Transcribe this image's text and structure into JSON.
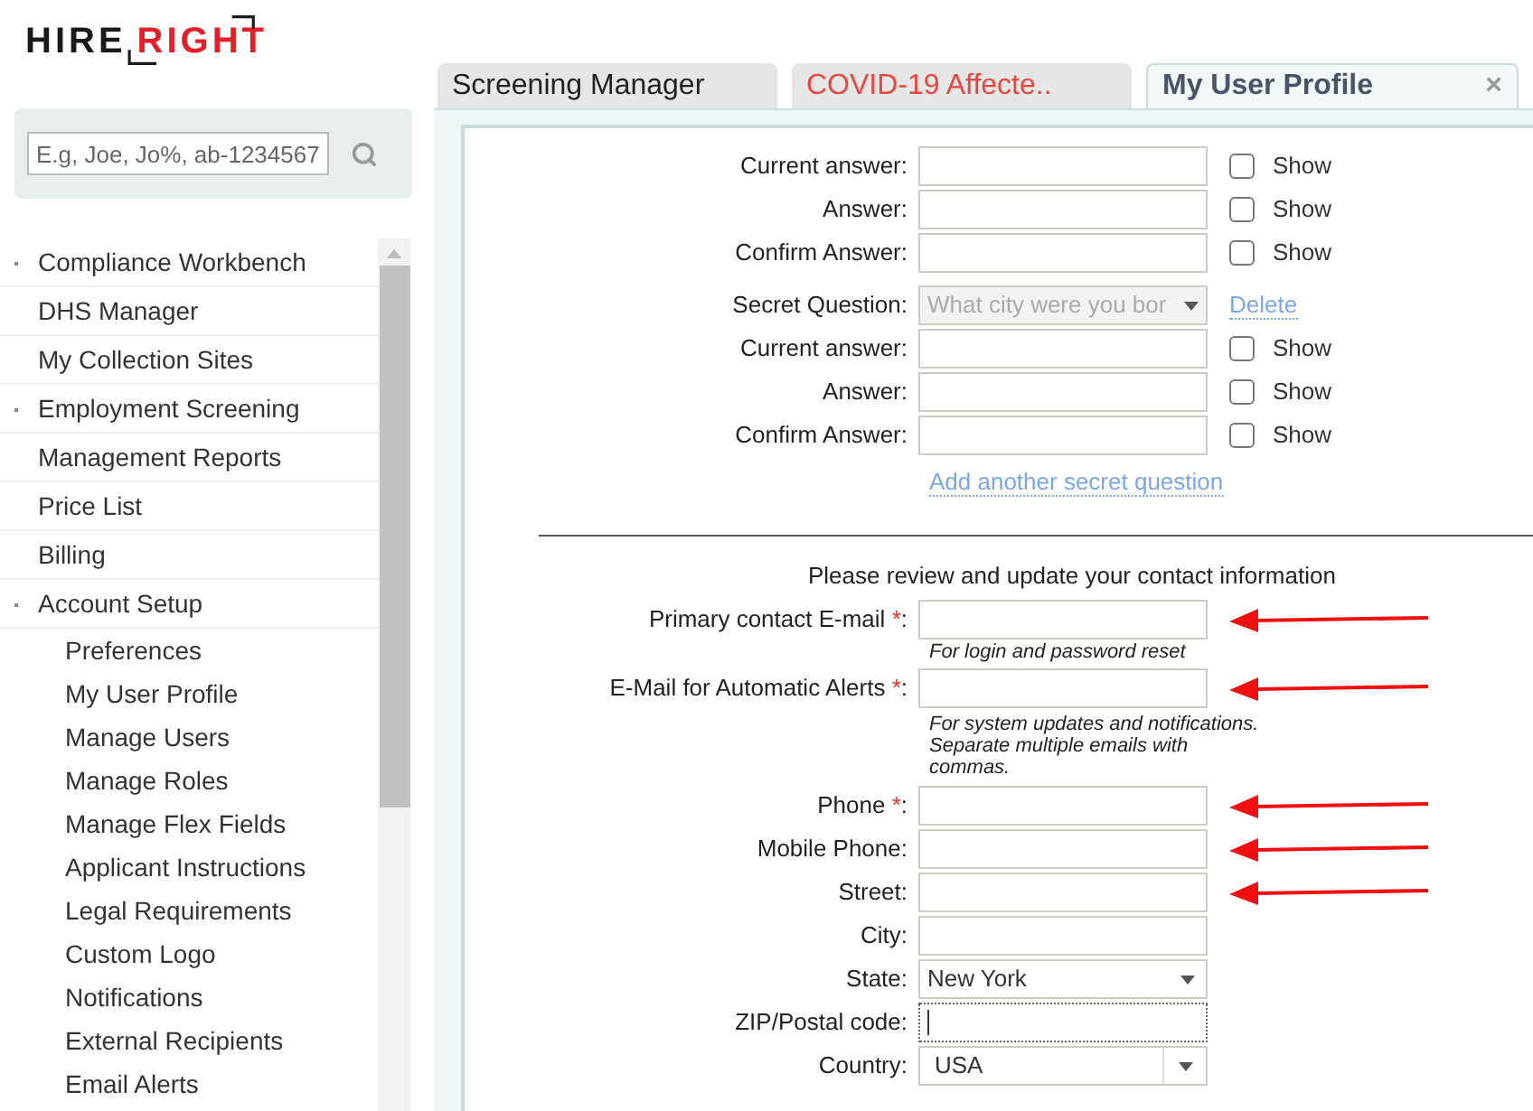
{
  "logo": {
    "first": "HIRE",
    "second": "RIGHT"
  },
  "search": {
    "placeholder": "E.g, Joe, Jo%, ab-1234567"
  },
  "sidebar": {
    "items": [
      {
        "label": "Compliance Workbench",
        "expandable": true
      },
      {
        "label": "DHS Manager",
        "expandable": false
      },
      {
        "label": "My Collection Sites",
        "expandable": false
      },
      {
        "label": "Employment Screening",
        "expandable": true
      },
      {
        "label": "Management Reports",
        "expandable": false
      },
      {
        "label": "Price List",
        "expandable": false
      },
      {
        "label": "Billing",
        "expandable": false
      },
      {
        "label": "Account Setup",
        "expandable": true,
        "children": [
          {
            "label": "Preferences"
          },
          {
            "label": "My User Profile"
          },
          {
            "label": "Manage Users"
          },
          {
            "label": "Manage Roles"
          },
          {
            "label": "Manage Flex Fields"
          },
          {
            "label": "Applicant Instructions"
          },
          {
            "label": "Legal Requirements"
          },
          {
            "label": "Custom Logo"
          },
          {
            "label": "Notifications"
          },
          {
            "label": "External Recipients"
          },
          {
            "label": "Email Alerts"
          }
        ]
      }
    ]
  },
  "tabs": [
    {
      "label": "Screening Manager",
      "selected": false,
      "alert": false
    },
    {
      "label": "COVID-19 Affecte..",
      "selected": false,
      "alert": true
    },
    {
      "label": "My User Profile",
      "selected": true,
      "alert": false,
      "close": "×"
    }
  ],
  "answer_group": [
    {
      "label": "Current answer:",
      "show": {
        "label": "Show",
        "checked": false
      }
    },
    {
      "label": "Answer:",
      "show": {
        "label": "Show",
        "checked": false
      }
    },
    {
      "label": "Confirm Answer:",
      "show": {
        "label": "Show",
        "checked": false
      }
    }
  ],
  "secret_question": {
    "label": "Secret Question:",
    "value": "What city were you bor",
    "disabled": true,
    "delete_link": "Delete",
    "rows": [
      {
        "label": "Current answer:",
        "show": {
          "label": "Show",
          "checked": false
        }
      },
      {
        "label": "Answer:",
        "show": {
          "label": "Show",
          "checked": false
        }
      },
      {
        "label": "Confirm Answer:",
        "show": {
          "label": "Show",
          "checked": false
        }
      }
    ]
  },
  "add_question_link": "Add another secret question",
  "contact": {
    "heading": "Please review and update your contact information",
    "fields": [
      {
        "kind": "text",
        "label": "Primary contact E-mail ",
        "required_mark": "*",
        "label_end": ":",
        "hint": [
          "For login and password reset"
        ],
        "arrow": true
      },
      {
        "kind": "text",
        "label": "E-Mail for Automatic Alerts ",
        "required_mark": "*",
        "label_end": ":",
        "hint": [
          "For system updates and notifications.",
          "Separate multiple emails with",
          "commas."
        ],
        "arrow": true
      },
      {
        "kind": "text",
        "label": "Phone ",
        "required_mark": "*",
        "label_end": ":",
        "arrow": true
      },
      {
        "kind": "text",
        "label": "Mobile Phone:",
        "arrow": true
      },
      {
        "kind": "text",
        "label": "Street:",
        "arrow": true
      },
      {
        "kind": "text",
        "label": "City:",
        "arrow": false
      },
      {
        "kind": "select",
        "label": "State:",
        "value": "New York",
        "arrow": false
      },
      {
        "kind": "text",
        "label": "ZIP/Postal code:",
        "arrow": false,
        "focused": true
      },
      {
        "kind": "combo",
        "label": "Country:",
        "value": "USA",
        "arrow": false
      }
    ]
  }
}
